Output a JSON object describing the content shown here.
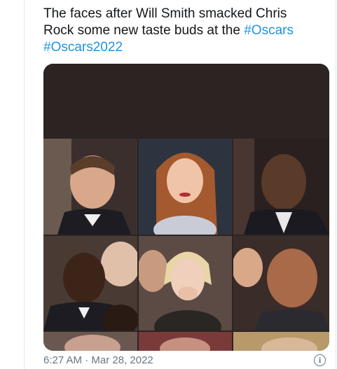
{
  "tweet": {
    "text_line1": "The faces after Will Smith smacked Chris",
    "text_line2_plain": "Rock some new taste buds at the ",
    "hashtag1": "#Oscars",
    "hashtag2": "#Oscars2022",
    "timestamp": "6:27 AM · Mar 28, 2022",
    "info_icon_glyph": "i"
  },
  "media": {
    "icon": "photo-grid",
    "cells": [
      "reaction-1",
      "reaction-2",
      "reaction-3",
      "reaction-4",
      "reaction-5",
      "reaction-6",
      "reaction-7",
      "reaction-8",
      "reaction-9"
    ]
  },
  "colors": {
    "link": "#1b95e0",
    "text": "#14171a",
    "secondary": "#657786",
    "border": "#e1e8ed"
  }
}
